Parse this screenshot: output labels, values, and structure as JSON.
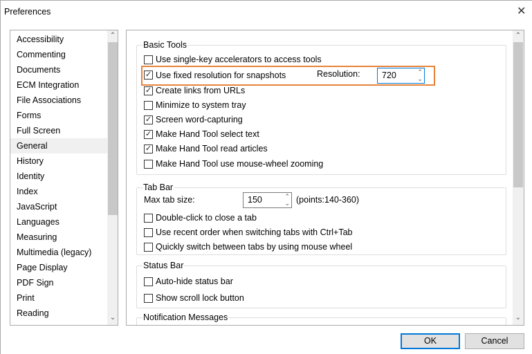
{
  "window": {
    "title": "Preferences",
    "close_icon": "close-icon"
  },
  "sidebar": {
    "selected": "General",
    "items": [
      "Accessibility",
      "Commenting",
      "Documents",
      "ECM Integration",
      "File Associations",
      "Forms",
      "Full Screen",
      "General",
      "History",
      "Identity",
      "Index",
      "JavaScript",
      "Languages",
      "Measuring",
      "Multimedia (legacy)",
      "Page Display",
      "PDF Sign",
      "Print",
      "Reading"
    ]
  },
  "basic_tools": {
    "title": "Basic Tools",
    "options": [
      {
        "label": "Use single-key accelerators to access tools",
        "checked": false
      },
      {
        "label": "Use fixed resolution for snapshots",
        "checked": true
      },
      {
        "label": "Create links from URLs",
        "checked": true
      },
      {
        "label": "Minimize to system tray",
        "checked": false
      },
      {
        "label": "Screen word-capturing",
        "checked": true
      },
      {
        "label": "Make Hand Tool select text",
        "checked": true
      },
      {
        "label": "Make Hand Tool read articles",
        "checked": true
      },
      {
        "label": "Make Hand Tool use mouse-wheel zooming",
        "checked": false
      }
    ],
    "resolution_label": "Resolution:",
    "resolution_value": "720",
    "highlight_color": "#e8823a"
  },
  "tab_bar": {
    "title": "Tab Bar",
    "max_tab_label": "Max tab size:",
    "max_tab_value": "150",
    "range_hint": "(points:140-360)",
    "options": [
      {
        "label": "Double-click to close a tab",
        "checked": false
      },
      {
        "label": "Use recent order when switching tabs with Ctrl+Tab",
        "checked": false
      },
      {
        "label": "Quickly switch between tabs by using mouse wheel",
        "checked": false
      }
    ]
  },
  "status_bar": {
    "title": "Status Bar",
    "options": [
      {
        "label": "Auto-hide status bar",
        "checked": false
      },
      {
        "label": "Show scroll lock button",
        "checked": false
      }
    ]
  },
  "notification": {
    "title": "Notification Messages"
  },
  "buttons": {
    "ok": "OK",
    "cancel": "Cancel"
  }
}
